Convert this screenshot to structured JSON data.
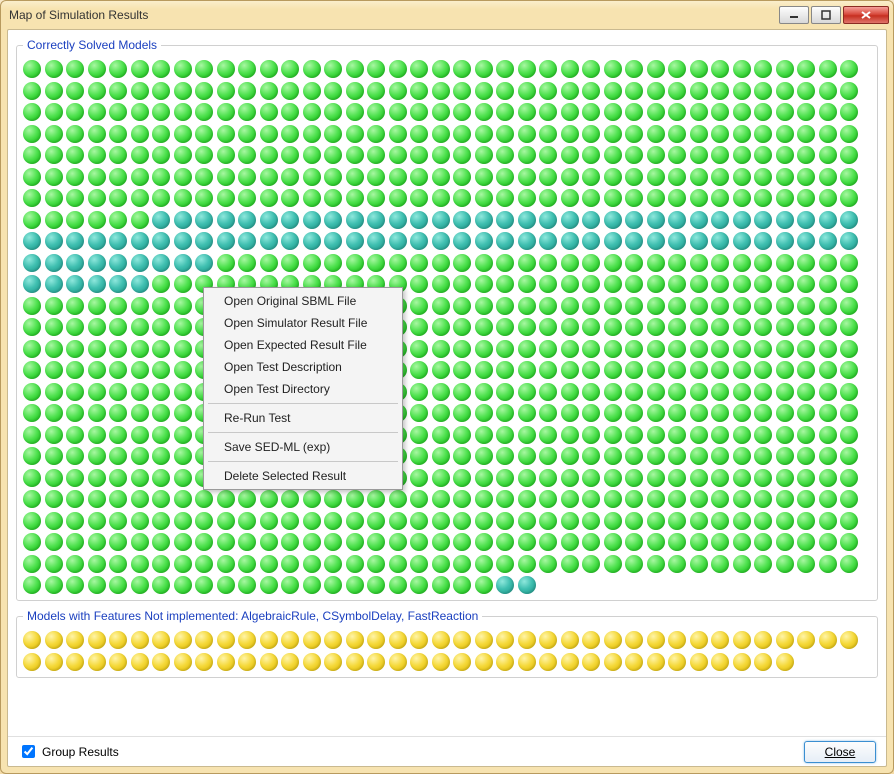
{
  "window": {
    "title": "Map of Simulation Results"
  },
  "groups": {
    "solved": {
      "legend": "Correctly Solved Models",
      "rows": [
        {
          "color": "green",
          "count": 39
        },
        {
          "color": "green",
          "count": 39
        },
        {
          "color": "green",
          "count": 39
        },
        {
          "color": "green",
          "count": 39
        },
        {
          "color": "green",
          "count": 39
        },
        {
          "color": "green",
          "count": 39
        },
        {
          "color": "green",
          "count": 39
        },
        {
          "color": "mixed",
          "segments": [
            {
              "color": "green",
              "count": 6
            },
            {
              "color": "teal",
              "count": 33
            }
          ]
        },
        {
          "color": "teal",
          "count": 39
        },
        {
          "color": "mixed",
          "segments": [
            {
              "color": "teal",
              "count": 9
            },
            {
              "color": "green",
              "count": 30
            }
          ]
        },
        {
          "color": "mixed",
          "segments": [
            {
              "color": "teal",
              "count": 6
            },
            {
              "color": "green",
              "count": 33
            }
          ]
        },
        {
          "color": "green",
          "count": 39
        },
        {
          "color": "green",
          "count": 39
        },
        {
          "color": "green",
          "count": 39
        },
        {
          "color": "green",
          "count": 39
        },
        {
          "color": "green",
          "count": 39
        },
        {
          "color": "green",
          "count": 39
        },
        {
          "color": "green",
          "count": 39
        },
        {
          "color": "green",
          "count": 39
        },
        {
          "color": "green",
          "count": 39
        },
        {
          "color": "green",
          "count": 39
        },
        {
          "color": "green",
          "count": 39
        },
        {
          "color": "green",
          "count": 39
        },
        {
          "color": "green",
          "count": 39
        },
        {
          "color": "mixed",
          "segments": [
            {
              "color": "green",
              "count": 22
            },
            {
              "color": "teal",
              "count": 2
            }
          ]
        }
      ]
    },
    "notimpl": {
      "legend": "Models with Features Not implemented: AlgebraicRule, CSymbolDelay, FastReaction",
      "rows": [
        {
          "color": "yellow",
          "count": 39
        },
        {
          "color": "yellow",
          "count": 36
        }
      ]
    }
  },
  "contextMenu": {
    "items": [
      "Open Original SBML File",
      "Open Simulator Result File",
      "Open Expected Result File",
      "Open Test Description",
      "Open Test Directory",
      "---",
      "Re-Run Test",
      "---",
      "Save SED-ML (exp)",
      "---",
      "Delete Selected Result"
    ]
  },
  "bottom": {
    "checkbox_label": "Group Results",
    "checkbox_checked": true,
    "close_label": "Close"
  }
}
